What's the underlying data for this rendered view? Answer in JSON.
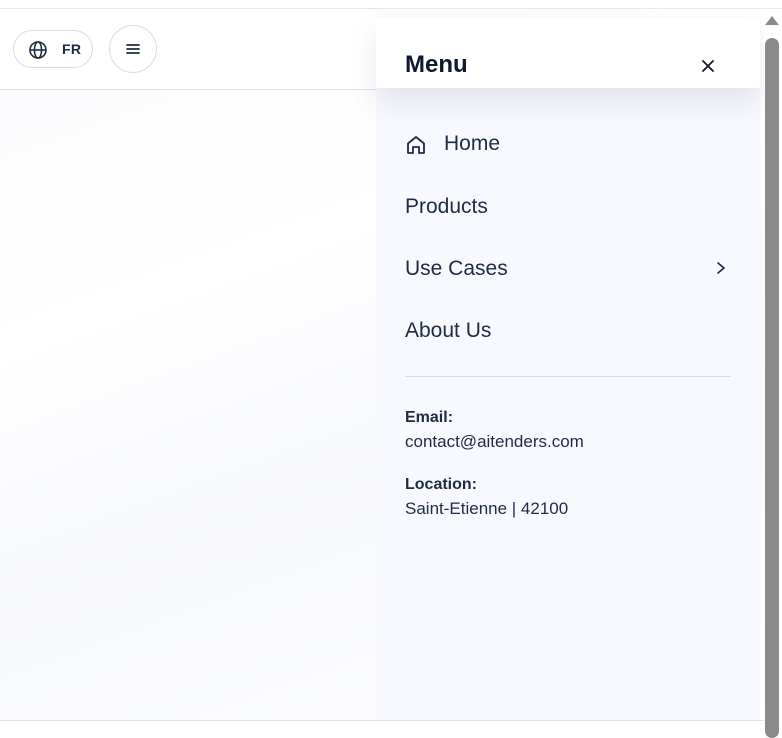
{
  "header": {
    "language_label": "FR",
    "icons": {
      "language": "globe-icon",
      "menu": "hamburger-icon"
    }
  },
  "drawer": {
    "title": "Menu",
    "close_icon": "close-icon",
    "nav": [
      {
        "label": "Home",
        "icon": "home-icon"
      },
      {
        "label": "Products"
      },
      {
        "label": "Use Cases",
        "icon": "chevron-right-icon"
      },
      {
        "label": "About Us"
      }
    ],
    "contact": {
      "email_label": "Email:",
      "email_value": "contact@aitenders.com",
      "location_label": "Location:",
      "location_value": "Saint-Etienne | 42100"
    }
  },
  "colors": {
    "text": "#1f2a44",
    "title": "#0f1830",
    "drawer_bg": "#f8f9fe",
    "border": "#d6dbee",
    "scrollbar": "#8a8a8a"
  }
}
